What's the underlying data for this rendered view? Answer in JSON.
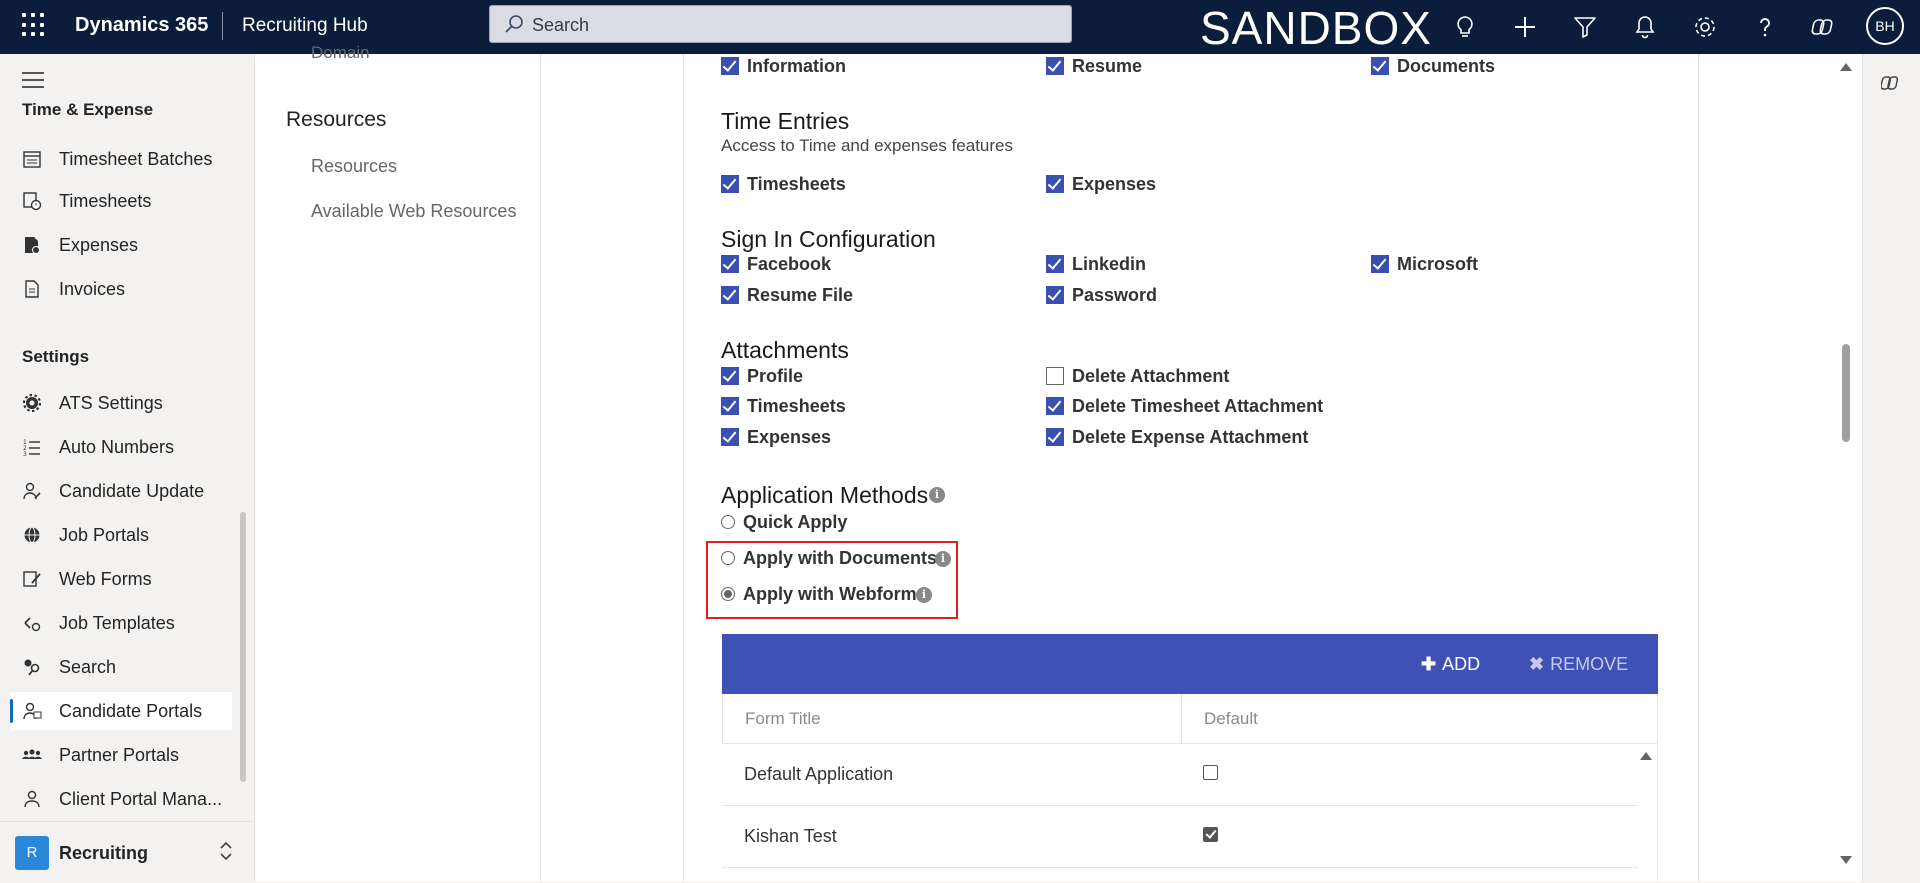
{
  "topbar": {
    "brand": "Dynamics 365",
    "app_name": "Recruiting Hub",
    "search_placeholder": "Search",
    "environment_label": "SANDBOX",
    "user_initials": "BH"
  },
  "leftnav": {
    "group_time": "Time & Expense",
    "time_items": [
      {
        "label": "Timesheet Batches",
        "icon": "calendar-list-icon"
      },
      {
        "label": "Timesheets",
        "icon": "timesheet-clock-icon"
      },
      {
        "label": "Expenses",
        "icon": "expense-document-icon"
      },
      {
        "label": "Invoices",
        "icon": "invoice-icon"
      }
    ],
    "group_settings": "Settings",
    "settings_items": [
      {
        "label": "ATS Settings",
        "icon": "gear-icon"
      },
      {
        "label": "Auto Numbers",
        "icon": "numbered-list-icon"
      },
      {
        "label": "Candidate Update",
        "icon": "person-edit-icon"
      },
      {
        "label": "Job Portals",
        "icon": "globe-icon"
      },
      {
        "label": "Web Forms",
        "icon": "form-edit-icon"
      },
      {
        "label": "Job Templates",
        "icon": "template-icon"
      },
      {
        "label": "Search",
        "icon": "search-people-icon"
      },
      {
        "label": "Candidate Portals",
        "icon": "people-icon",
        "selected": true
      },
      {
        "label": "Partner Portals",
        "icon": "group-icon"
      },
      {
        "label": "Client Portal Mana...",
        "icon": "person-portal-icon"
      }
    ],
    "area": {
      "badge": "R",
      "label": "Recruiting"
    }
  },
  "subnav": {
    "cut_item": "Domain",
    "heading": "Resources",
    "links": [
      "Resources",
      "Available Web Resources"
    ]
  },
  "form": {
    "top_row": [
      {
        "label": "Information",
        "checked": true
      },
      {
        "label": "Resume",
        "checked": true
      },
      {
        "label": "Documents",
        "checked": true
      }
    ],
    "time_entries": {
      "title": "Time Entries",
      "subtitle": "Access to Time and expenses features",
      "items": [
        {
          "label": "Timesheets",
          "checked": true
        },
        {
          "label": "Expenses",
          "checked": true
        }
      ]
    },
    "sign_in": {
      "title": "Sign In Configuration",
      "items": [
        {
          "label": "Facebook",
          "checked": true
        },
        {
          "label": "Linkedin",
          "checked": true
        },
        {
          "label": "Microsoft",
          "checked": true
        },
        {
          "label": "Resume File",
          "checked": true
        },
        {
          "label": "Password",
          "checked": true
        }
      ]
    },
    "attachments": {
      "title": "Attachments",
      "items": [
        {
          "label": "Profile",
          "checked": true
        },
        {
          "label": "Delete Attachment",
          "checked": false
        },
        {
          "label": "Timesheets",
          "checked": true
        },
        {
          "label": "Delete Timesheet Attachment",
          "checked": true
        },
        {
          "label": "Expenses",
          "checked": true
        },
        {
          "label": "Delete Expense Attachment",
          "checked": true
        }
      ]
    },
    "application_methods": {
      "title": "Application Methods",
      "options": [
        {
          "label": "Quick Apply",
          "selected": false
        },
        {
          "label": "Apply with Documents",
          "selected": false
        },
        {
          "label": "Apply with Webform",
          "selected": true
        }
      ]
    },
    "grid": {
      "add_label": "ADD",
      "remove_label": "REMOVE",
      "columns": [
        "Form Title",
        "Default"
      ],
      "rows": [
        {
          "title": "Default Application",
          "default": false
        },
        {
          "title": "Kishan Test",
          "default": true
        }
      ]
    }
  },
  "colors": {
    "topbar_bg": "#0b1d3a",
    "checkbox_accent": "#3b4fb0",
    "grid_header": "#3f51b5",
    "highlight_border": "#e02020",
    "selected_indicator": "#0f6cbd"
  }
}
